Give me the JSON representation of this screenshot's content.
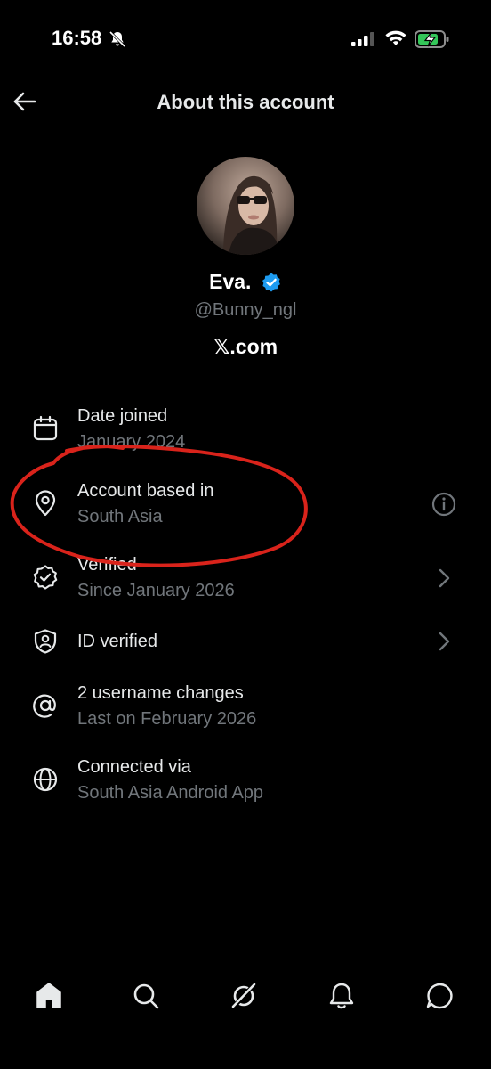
{
  "status_bar": {
    "time": "16:58",
    "icons": [
      "bell-slash-icon",
      "signal-icon",
      "wifi-icon",
      "battery-charging-icon"
    ]
  },
  "header": {
    "title": "About this account",
    "back_icon": "arrow-left-icon"
  },
  "profile": {
    "name": "Eva.",
    "handle": "@Bunny_ngl",
    "site": "𝕏.com",
    "verified_color": "#1d9bf0"
  },
  "details": [
    {
      "icon": "calendar-icon",
      "label": "Date joined",
      "value": "January 2024"
    },
    {
      "icon": "location-pin-icon",
      "label": "Account based in",
      "value": "South Asia",
      "action_icon": "info-icon"
    },
    {
      "icon": "verified-badge-icon",
      "label": "Verified",
      "value": "Since January 2026",
      "action_icon": "chevron-right-icon"
    },
    {
      "icon": "id-shield-icon",
      "label": "ID verified",
      "action_icon": "chevron-right-icon"
    },
    {
      "icon": "at-sign-icon",
      "label": "2 username changes",
      "value": "Last on February 2026"
    },
    {
      "icon": "globe-icon",
      "label": "Connected via",
      "value": "South Asia Android App"
    }
  ],
  "annotation": {
    "color": "#d9231b",
    "shape": "hand-drawn-circle"
  },
  "tabbar": {
    "items": [
      "home-icon",
      "search-icon",
      "grok-icon",
      "notifications-icon",
      "messages-icon"
    ]
  },
  "colors": {
    "background": "#000000",
    "primary_text": "#e7e9ea",
    "secondary_text": "#71767b"
  }
}
